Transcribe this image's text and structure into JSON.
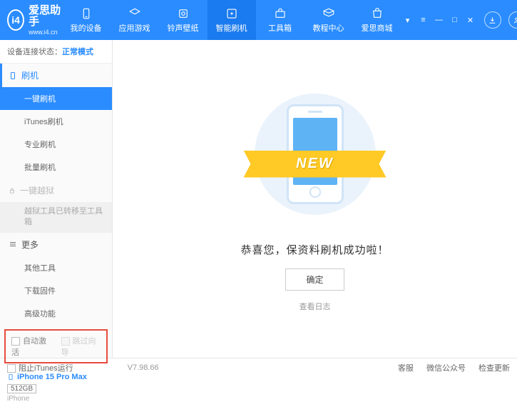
{
  "header": {
    "app_name": "爱思助手",
    "app_url": "www.i4.cn",
    "nav": [
      {
        "label": "我的设备"
      },
      {
        "label": "应用游戏"
      },
      {
        "label": "铃声壁纸"
      },
      {
        "label": "智能刷机"
      },
      {
        "label": "工具箱"
      },
      {
        "label": "教程中心"
      },
      {
        "label": "爱思商城"
      }
    ]
  },
  "status": {
    "label": "设备连接状态：",
    "value": "正常模式"
  },
  "sidebar": {
    "flash": {
      "title": "刷机",
      "items": [
        "一键刷机",
        "iTunes刷机",
        "专业刷机",
        "批量刷机"
      ]
    },
    "jailbreak": {
      "title": "一键越狱",
      "moved": "越狱工具已转移至工具箱"
    },
    "more": {
      "title": "更多",
      "items": [
        "其他工具",
        "下载固件",
        "高级功能"
      ]
    }
  },
  "options": {
    "auto_activate": "自动激活",
    "skip_wizard": "跳过向导"
  },
  "device": {
    "name": "iPhone 15 Pro Max",
    "capacity": "512GB",
    "type": "iPhone"
  },
  "main": {
    "ribbon": "NEW",
    "success": "恭喜您，保资料刷机成功啦！",
    "confirm": "确定",
    "view_log": "查看日志"
  },
  "footer": {
    "block_itunes": "阻止iTunes运行",
    "version": "V7.98.66",
    "links": [
      "客服",
      "微信公众号",
      "检查更新"
    ]
  }
}
